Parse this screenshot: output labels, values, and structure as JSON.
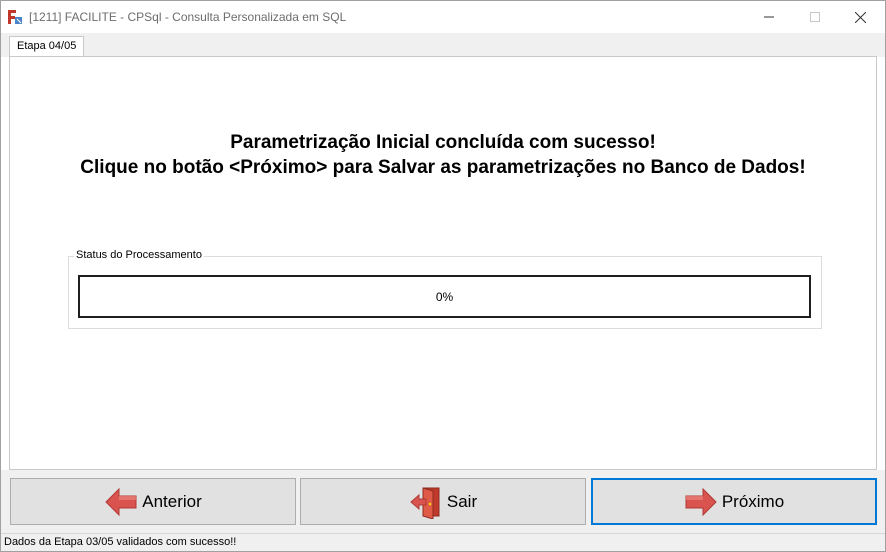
{
  "window": {
    "title": "[1211] FACILITE - CPSql - Consulta Personalizada em SQL"
  },
  "tabs": [
    {
      "label": "Etapa 04/05",
      "active": true
    }
  ],
  "main": {
    "heading_line1": "Parametrização Inicial concluída com sucesso!",
    "heading_line2": "Clique no botão <Próximo> para Salvar as parametrizações no Banco de Dados!",
    "status_group": {
      "label": "Status do Processamento",
      "progress_text": "0%",
      "progress_value": 0
    }
  },
  "buttons": {
    "previous": {
      "label": "Anterior",
      "icon": "left-arrow-icon"
    },
    "exit": {
      "label": "Sair",
      "icon": "exit-door-icon"
    },
    "next": {
      "label": "Próximo",
      "icon": "right-arrow-icon"
    }
  },
  "statusbar": {
    "text": "Dados da Etapa 03/05 validados com sucesso!!"
  },
  "colors": {
    "arrow": "#d9534f",
    "focus_border": "#0078d7",
    "progress_fill": "#06b025"
  }
}
